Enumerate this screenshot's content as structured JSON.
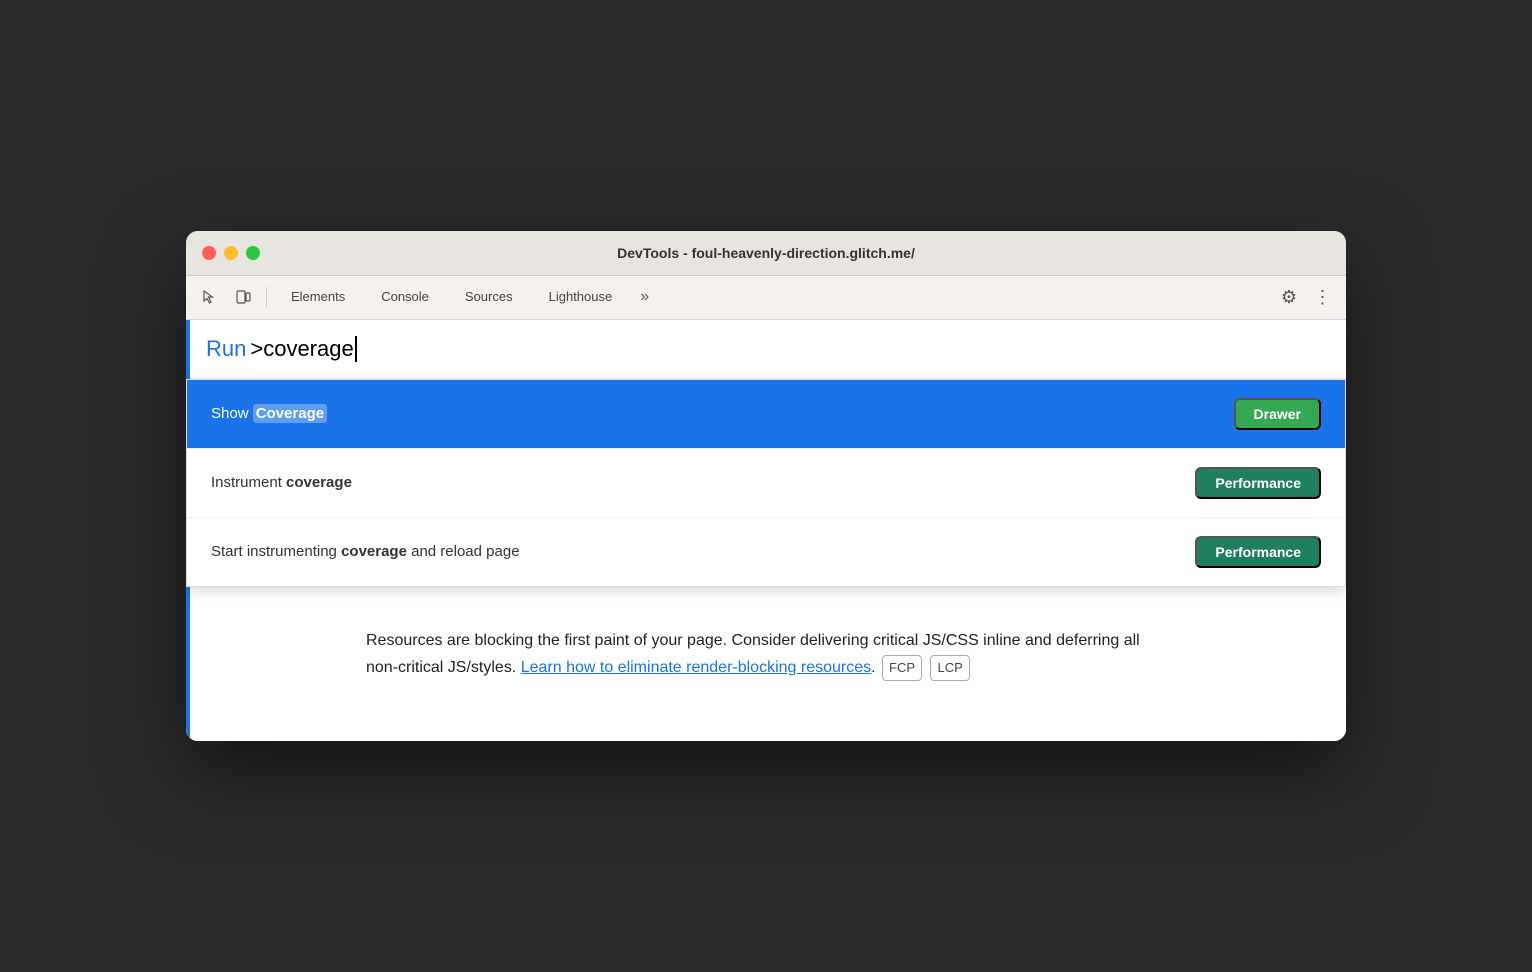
{
  "window": {
    "title": "DevTools - foul-heavenly-direction.glitch.me/"
  },
  "titleBar": {
    "trafficLights": [
      "red",
      "yellow",
      "green"
    ]
  },
  "toolbar": {
    "tabs": [
      {
        "id": "elements",
        "label": "Elements"
      },
      {
        "id": "console",
        "label": "Console"
      },
      {
        "id": "sources",
        "label": "Sources"
      },
      {
        "id": "lighthouse",
        "label": "Lighthouse"
      }
    ],
    "more": "»",
    "settingsIcon": "⚙",
    "dotsIcon": "⋮"
  },
  "commandInput": {
    "runLabel": "Run",
    "inputValue": ">coverage"
  },
  "suggestions": [
    {
      "id": "show-coverage",
      "labelPrefix": "Show ",
      "labelHighlight": "Coverage",
      "labelSuffix": "",
      "badge": "Drawer",
      "badgeType": "drawer",
      "active": true
    },
    {
      "id": "instrument-coverage",
      "labelPrefix": "Instrument ",
      "labelBold": "coverage",
      "labelSuffix": "",
      "badge": "Performance",
      "badgeType": "performance",
      "active": false
    },
    {
      "id": "start-instrumenting",
      "labelPrefix": "Start instrumenting ",
      "labelBold": "coverage",
      "labelSuffix": " and reload page",
      "badge": "Performance",
      "badgeType": "performance",
      "active": false
    }
  ],
  "contentText": {
    "main": "Resources are blocking the first paint of your page. Consider delivering critical JS/CSS inline and deferring all non-critical JS/styles. ",
    "linkText": "Learn how to eliminate render-blocking resources",
    "afterLink": ". ",
    "tags": [
      "FCP",
      "LCP"
    ]
  }
}
